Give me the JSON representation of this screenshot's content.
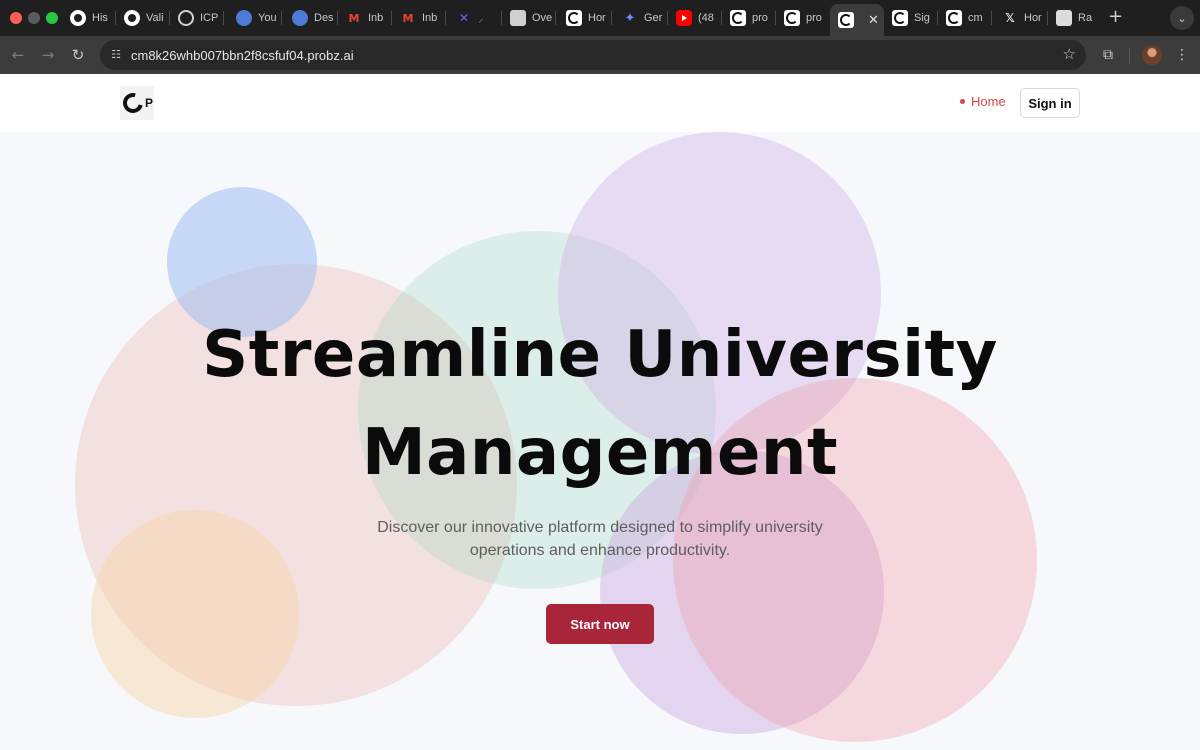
{
  "browser": {
    "tabs": [
      {
        "title": "His",
        "icon": "github-icon"
      },
      {
        "title": "Vali",
        "icon": "github-icon"
      },
      {
        "title": "ICP",
        "icon": "openai-icon"
      },
      {
        "title": "You",
        "icon": "probz-blue-icon"
      },
      {
        "title": "Des",
        "icon": "probz-blue-icon"
      },
      {
        "title": "Inb",
        "icon": "gmail-icon"
      },
      {
        "title": "Inb",
        "icon": "gmail-icon"
      },
      {
        "title": "",
        "icon": "x-purple-icon"
      },
      {
        "title": "Ove",
        "icon": "car-icon"
      },
      {
        "title": "Hor",
        "icon": "probz-icon"
      },
      {
        "title": "Ger",
        "icon": "gemini-icon"
      },
      {
        "title": "(48",
        "icon": "youtube-icon"
      },
      {
        "title": "pro",
        "icon": "probz-icon"
      },
      {
        "title": "pro",
        "icon": "probz-icon"
      },
      {
        "title": "",
        "icon": "probz-icon",
        "active": true
      },
      {
        "title": "Sig",
        "icon": "probz-icon"
      },
      {
        "title": "cm",
        "icon": "probz-icon"
      },
      {
        "title": "Hor",
        "icon": "x-logo-icon"
      },
      {
        "title": "Ra",
        "icon": "raw-icon"
      }
    ],
    "url": "cm8k26whb007bbn2f8csfuf04.probz.ai"
  },
  "nav": {
    "logo_letter": "P",
    "home_label": "Home",
    "signin_label": "Sign in"
  },
  "hero": {
    "headline_line1": "Streamline University",
    "headline_line2": "Management",
    "subtext_line1": "Discover our innovative platform designed to simplify university",
    "subtext_line2": "operations and enhance productivity.",
    "cta_label": "Start now"
  },
  "colors": {
    "accent": "#a8253a",
    "home_active": "#d64545",
    "headline": "#0b0b0b"
  }
}
